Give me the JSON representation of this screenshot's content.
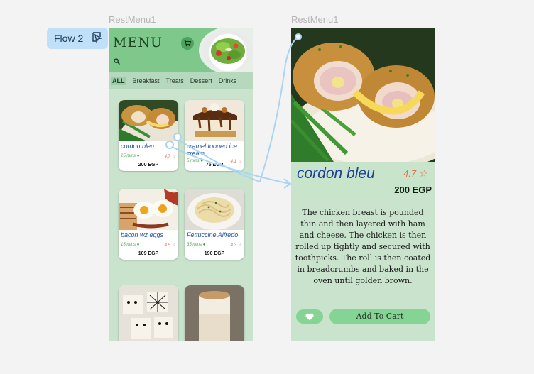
{
  "canvas": {
    "frame1_label": "RestMenu1",
    "frame2_label": "RestMenu1",
    "flow_badge": "Flow 2"
  },
  "menu": {
    "title": "MENU",
    "categories": [
      "ALL",
      "Breakfast",
      "Treats",
      "Dessert",
      "Drinks"
    ],
    "items": [
      {
        "name": "cordon bleu",
        "time": "25 mins",
        "rating": "4.7",
        "price": "200 EGP"
      },
      {
        "name": "cramel tooped ice cream",
        "time": "5 mins",
        "rating": "4.1",
        "price": "75 EGP"
      },
      {
        "name": "bacon wz eggs",
        "time": "15 mins",
        "rating": "4.5",
        "price": "109 EGP"
      },
      {
        "name": "Fettuccine Alfredo",
        "time": "35 mins",
        "rating": "4.3",
        "price": "190 EGP"
      }
    ]
  },
  "detail": {
    "title": "cordon bleu",
    "rating": "4.7",
    "price": "200 EGP",
    "description": "The chicken breast is pounded thin and then layered with ham and cheese. The chicken is then rolled up tightly and secured with toothpicks. The roll is then coated in breadcrumbs and baked in the oven until golden brown.",
    "add_to_cart": "Add To Cart"
  },
  "colors": {
    "header_green": "#7ec88c",
    "panel_green": "#c9e3cd",
    "button_green": "#86d396",
    "title_blue": "#1d3f96",
    "rating_orange": "#e36f4d",
    "flow_blue": "#bfe0f8"
  },
  "icons": [
    "flow-play-icon",
    "cart-icon",
    "search-icon",
    "star-icon",
    "clock-icon",
    "heart-icon"
  ]
}
